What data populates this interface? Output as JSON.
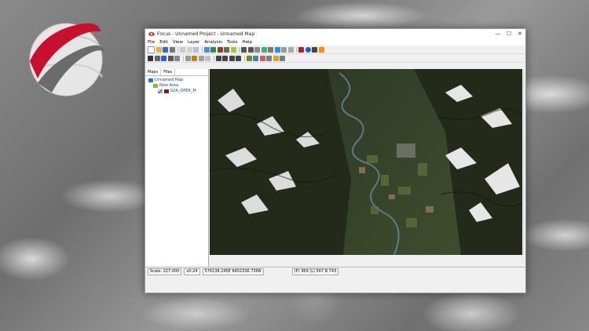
{
  "window": {
    "title": "Focus - Unnamed Project - Unnamed Map",
    "controls": {
      "minimize": "—",
      "maximize": "☐",
      "close": "✕"
    }
  },
  "menu": [
    "File",
    "Edit",
    "View",
    "Layer",
    "Analysis",
    "Tools",
    "Help"
  ],
  "panel": {
    "tabs": [
      "Maps",
      "Files"
    ],
    "tree": {
      "map": "Unnamed Map",
      "area": "New Area",
      "layer": "S2A_OPER_M"
    }
  },
  "status": {
    "scale": "Scale: 227,000",
    "zoom": "x0.24",
    "coords": "576138.245E 6452336.736N",
    "pixel": "(P) 369 (L) 567 B 743"
  },
  "colors": {
    "accent": "#c8102e",
    "window": "#f0f0f0",
    "map_bg": "#1c2214"
  }
}
